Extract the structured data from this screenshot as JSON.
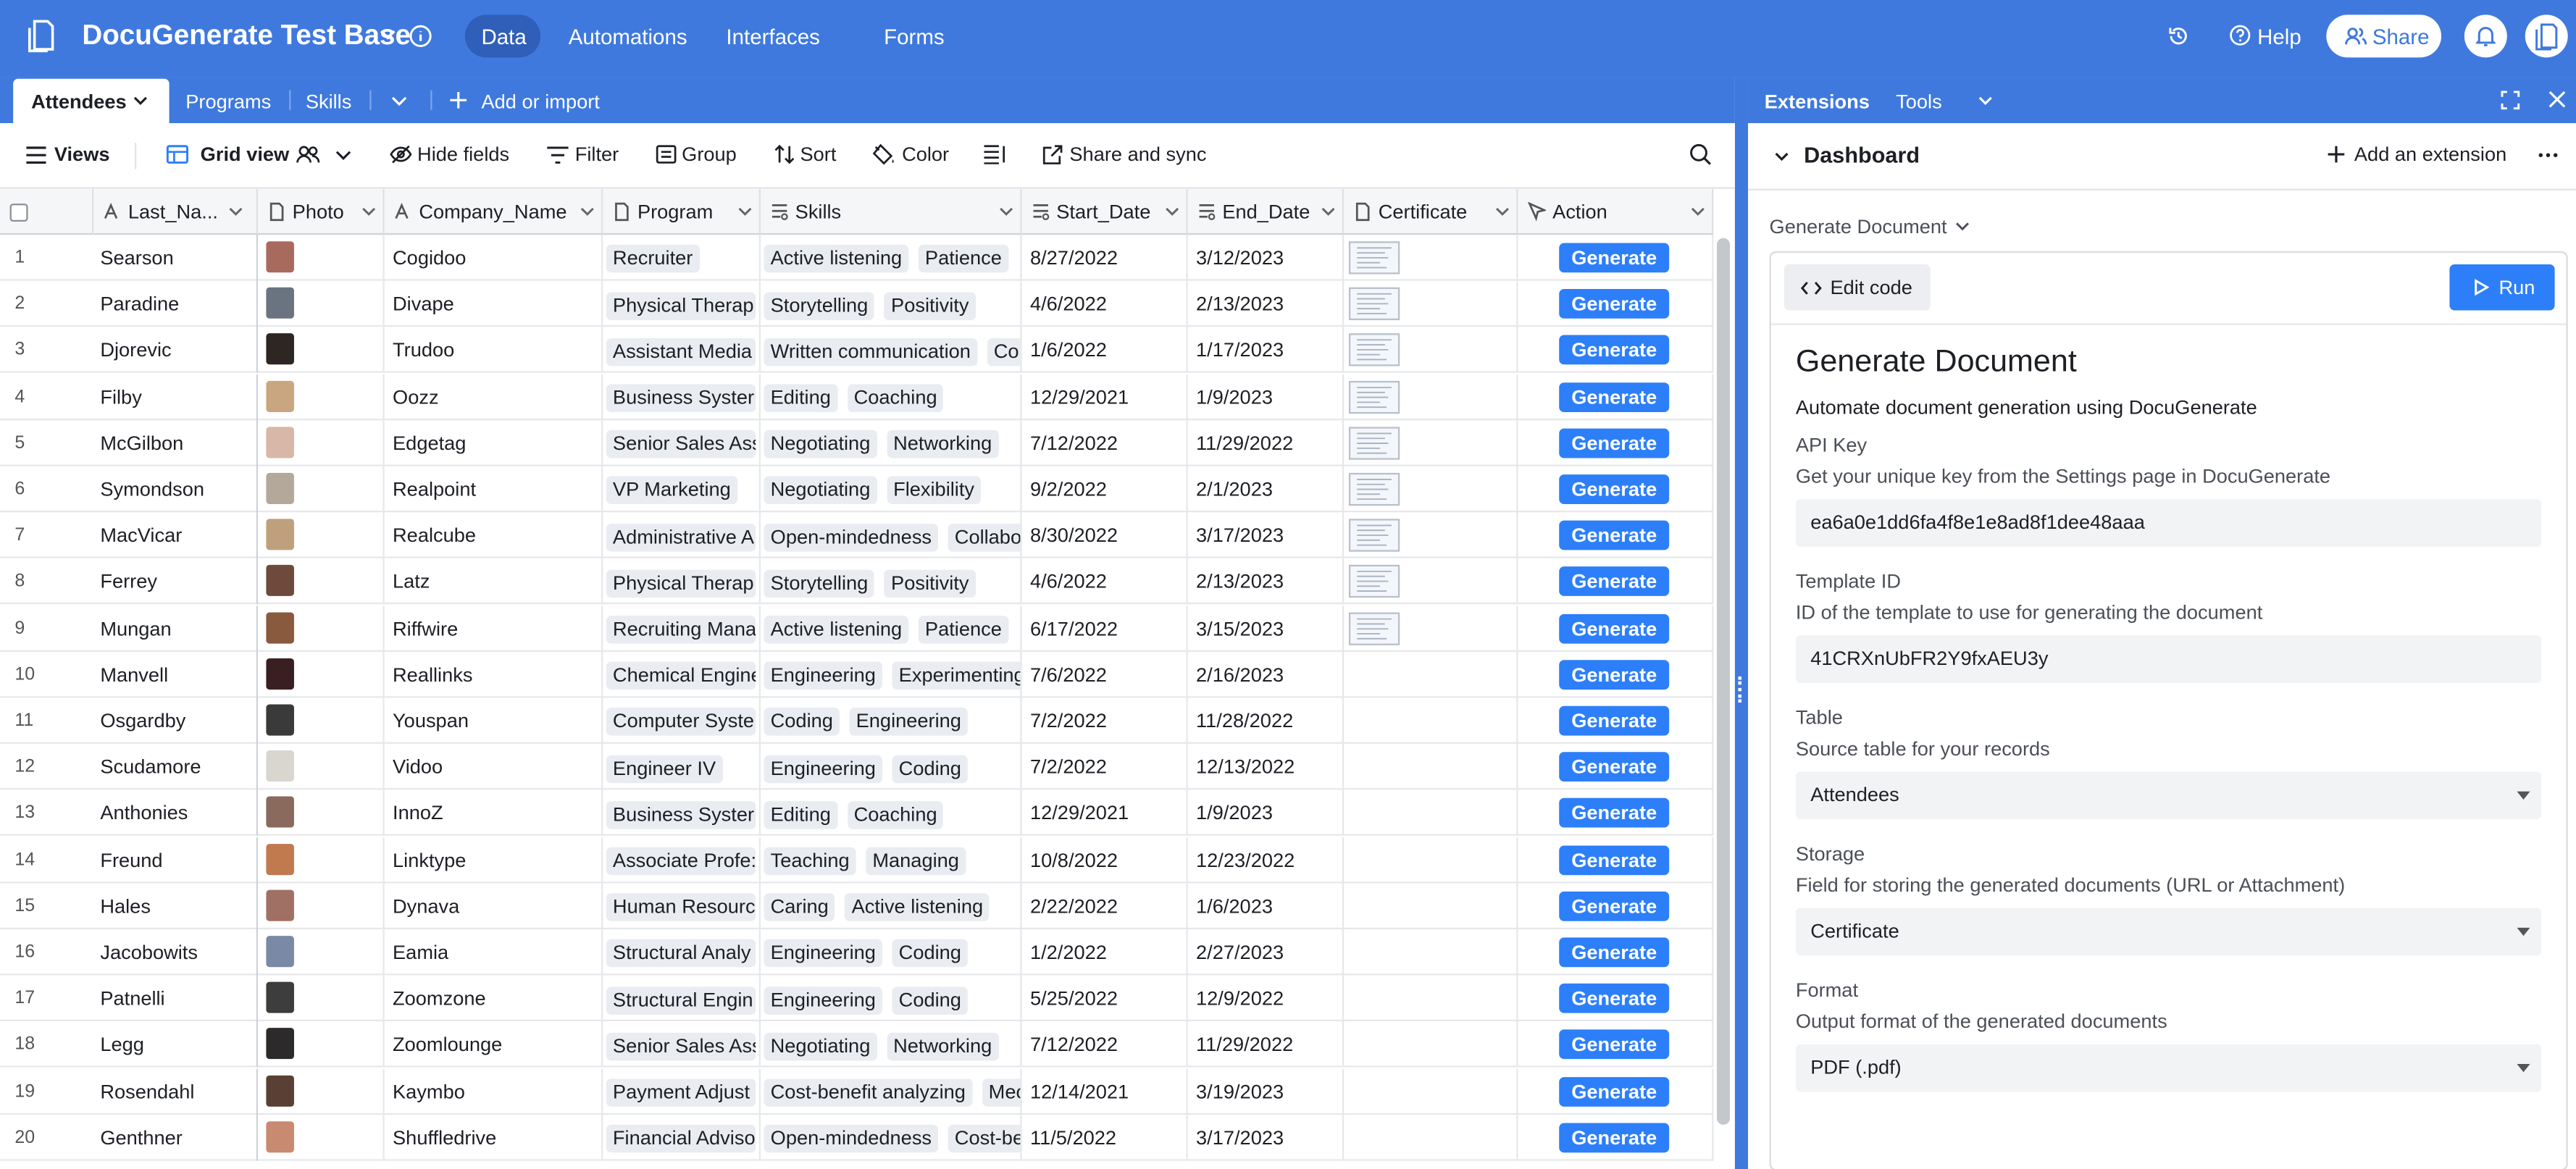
{
  "app": {
    "base_name": "DocuGenerate Test Base",
    "nav": [
      "Data",
      "Automations",
      "Interfaces",
      "Forms"
    ],
    "help_label": "Help",
    "share_label": "Share"
  },
  "tabs": {
    "items": [
      "Attendees",
      "Programs",
      "Skills"
    ],
    "add_label": "Add or import"
  },
  "toolbar": {
    "views": "Views",
    "grid_view": "Grid view",
    "hide_fields": "Hide fields",
    "filter": "Filter",
    "group": "Group",
    "sort": "Sort",
    "color": "Color",
    "share_sync": "Share and sync"
  },
  "columns": [
    "Last_Na...",
    "Photo",
    "Company_Name",
    "Program",
    "Skills",
    "Start_Date",
    "End_Date",
    "Certificate",
    "Action"
  ],
  "rows": [
    {
      "n": "1",
      "last": "Searson",
      "company": "Cogidoo",
      "program": "Recruiter",
      "skills": [
        "Active listening",
        "Patience"
      ],
      "start": "8/27/2022",
      "end": "3/12/2023",
      "cert": true,
      "photo": "#a96a5e"
    },
    {
      "n": "2",
      "last": "Paradine",
      "company": "Divape",
      "program": "Physical Therap",
      "skills": [
        "Storytelling",
        "Positivity"
      ],
      "start": "4/6/2022",
      "end": "2/13/2023",
      "cert": true,
      "photo": "#6a7480"
    },
    {
      "n": "3",
      "last": "Djorevic",
      "company": "Trudoo",
      "program": "Assistant Media",
      "skills": [
        "Written communication",
        "Co"
      ],
      "start": "1/6/2022",
      "end": "1/17/2023",
      "cert": true,
      "photo": "#2e2622"
    },
    {
      "n": "4",
      "last": "Filby",
      "company": "Oozz",
      "program": "Business Syster",
      "skills": [
        "Editing",
        "Coaching"
      ],
      "start": "12/29/2021",
      "end": "1/9/2023",
      "cert": true,
      "photo": "#c9a680"
    },
    {
      "n": "5",
      "last": "McGilbon",
      "company": "Edgetag",
      "program": "Senior Sales Ass",
      "skills": [
        "Negotiating",
        "Networking"
      ],
      "start": "7/12/2022",
      "end": "11/29/2022",
      "cert": true,
      "photo": "#d8b6a8"
    },
    {
      "n": "6",
      "last": "Symondson",
      "company": "Realpoint",
      "program": "VP Marketing",
      "skills": [
        "Negotiating",
        "Flexibility"
      ],
      "start": "9/2/2022",
      "end": "2/1/2023",
      "cert": true,
      "photo": "#b4a89a"
    },
    {
      "n": "7",
      "last": "MacVicar",
      "company": "Realcube",
      "program": "Administrative A",
      "skills": [
        "Open-mindedness",
        "Collabo"
      ],
      "start": "8/30/2022",
      "end": "3/17/2023",
      "cert": true,
      "photo": "#c0a07c"
    },
    {
      "n": "8",
      "last": "Ferrey",
      "company": "Latz",
      "program": "Physical Therap",
      "skills": [
        "Storytelling",
        "Positivity"
      ],
      "start": "4/6/2022",
      "end": "2/13/2023",
      "cert": true,
      "photo": "#6d4a3c"
    },
    {
      "n": "9",
      "last": "Mungan",
      "company": "Riffwire",
      "program": "Recruiting Mana",
      "skills": [
        "Active listening",
        "Patience"
      ],
      "start": "6/17/2022",
      "end": "3/15/2023",
      "cert": true,
      "photo": "#8a5a3e"
    },
    {
      "n": "10",
      "last": "Manvell",
      "company": "Reallinks",
      "program": "Chemical Engine",
      "skills": [
        "Engineering",
        "Experimenting"
      ],
      "start": "7/6/2022",
      "end": "2/16/2023",
      "cert": false,
      "photo": "#3a1f22"
    },
    {
      "n": "11",
      "last": "Osgardby",
      "company": "Youspan",
      "program": "Computer Syste",
      "skills": [
        "Coding",
        "Engineering"
      ],
      "start": "7/2/2022",
      "end": "11/28/2022",
      "cert": false,
      "photo": "#3a3a3a"
    },
    {
      "n": "12",
      "last": "Scudamore",
      "company": "Vidoo",
      "program": "Engineer IV",
      "skills": [
        "Engineering",
        "Coding"
      ],
      "start": "7/2/2022",
      "end": "12/13/2022",
      "cert": false,
      "photo": "#d9d6d0"
    },
    {
      "n": "13",
      "last": "Anthonies",
      "company": "InnoZ",
      "program": "Business Syster",
      "skills": [
        "Editing",
        "Coaching"
      ],
      "start": "12/29/2021",
      "end": "1/9/2023",
      "cert": false,
      "photo": "#8a6a5c"
    },
    {
      "n": "14",
      "last": "Freund",
      "company": "Linktype",
      "program": "Associate Profe:",
      "skills": [
        "Teaching",
        "Managing"
      ],
      "start": "10/8/2022",
      "end": "12/23/2022",
      "cert": false,
      "photo": "#c07a4e"
    },
    {
      "n": "15",
      "last": "Hales",
      "company": "Dynava",
      "program": "Human Resourc",
      "skills": [
        "Caring",
        "Active listening"
      ],
      "start": "2/22/2022",
      "end": "1/6/2023",
      "cert": false,
      "photo": "#a07064"
    },
    {
      "n": "16",
      "last": "Jacobowits",
      "company": "Eamia",
      "program": "Structural Analy",
      "skills": [
        "Engineering",
        "Coding"
      ],
      "start": "1/2/2022",
      "end": "2/27/2023",
      "cert": false,
      "photo": "#7a8aa6"
    },
    {
      "n": "17",
      "last": "Patnelli",
      "company": "Zoomzone",
      "program": "Structural Engin",
      "skills": [
        "Engineering",
        "Coding"
      ],
      "start": "5/25/2022",
      "end": "12/9/2022",
      "cert": false,
      "photo": "#3d3d3d"
    },
    {
      "n": "18",
      "last": "Legg",
      "company": "Zoomlounge",
      "program": "Senior Sales Ass",
      "skills": [
        "Negotiating",
        "Networking"
      ],
      "start": "7/12/2022",
      "end": "11/29/2022",
      "cert": false,
      "photo": "#2c2a2a"
    },
    {
      "n": "19",
      "last": "Rosendahl",
      "company": "Kaymbo",
      "program": "Payment Adjust",
      "skills": [
        "Cost-benefit analyzing",
        "Mec"
      ],
      "start": "12/14/2021",
      "end": "3/19/2023",
      "cert": false,
      "photo": "#5a4034"
    },
    {
      "n": "20",
      "last": "Genthner",
      "company": "Shuffledrive",
      "program": "Financial Adviso",
      "skills": [
        "Open-mindedness",
        "Cost-be"
      ],
      "start": "11/5/2022",
      "end": "3/17/2023",
      "cert": false,
      "photo": "#c88a70"
    }
  ],
  "action_label": "Generate",
  "extensions": {
    "tab": "Extensions",
    "tools": "Tools",
    "dashboard": "Dashboard",
    "add_extension": "Add an extension",
    "selector": "Generate Document",
    "edit_code": "Edit code",
    "run": "Run",
    "title": "Generate Document",
    "subtitle": "Automate document generation using DocuGenerate",
    "fields": [
      {
        "label": "API Key",
        "help": "Get your unique key from the Settings page in DocuGenerate",
        "value": "ea6a0e1dd6fa4f8e1e8ad8f1dee48aaa",
        "select": false
      },
      {
        "label": "Template ID",
        "help": "ID of the template to use for generating the document",
        "value": "41CRXnUbFR2Y9fxAEU3y",
        "select": false
      },
      {
        "label": "Table",
        "help": "Source table for your records",
        "value": "Attendees",
        "select": true
      },
      {
        "label": "Storage",
        "help": "Field for storing the generated documents (URL or Attachment)",
        "value": "Certificate",
        "select": true
      },
      {
        "label": "Format",
        "help": "Output format of the generated documents",
        "value": "PDF (.pdf)",
        "select": true
      }
    ]
  },
  "colors": {
    "brand_blue": "#3f79de",
    "button_blue": "#2d7ff9"
  }
}
